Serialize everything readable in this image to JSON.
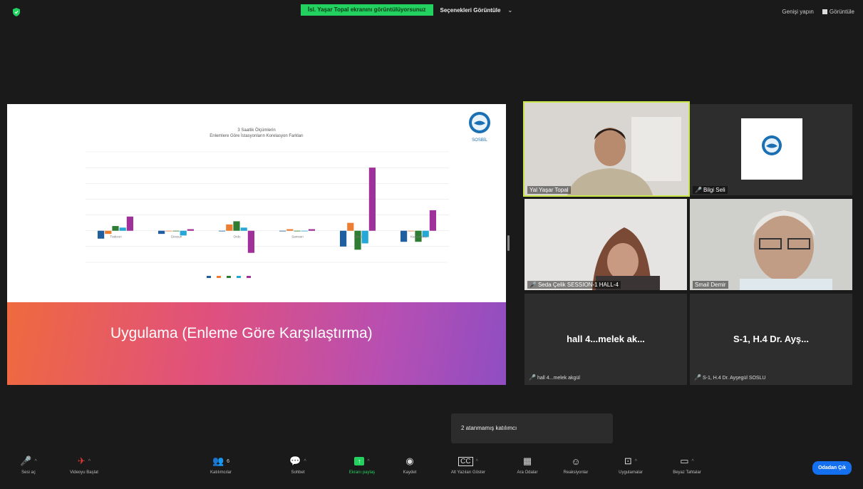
{
  "top": {
    "share_notice": "İsl. Yaşar Topal ekranını görüntülüyorsunuz",
    "view_options": "Seçenekleri Görüntüle",
    "view_options_chevron": "⌄",
    "exit_fullscreen": "Genişi yapın",
    "view_label": "Görüntüle"
  },
  "slide": {
    "banner_text": "Uygulama (Enleme Göre Karşılaştırma)",
    "logo_text": "SOSBİL",
    "chart_title_line1": "3 Saatlik Ölçümlerin",
    "chart_title_line2": "Enlemlere Göre İstasyonların Korelasyon Farkları"
  },
  "chart_data": {
    "type": "bar",
    "title": "3 Saatlik Ölçümlerin Enlemlere Göre İstasyonların Korelasyon Farkları",
    "categories": [
      "Trabzon",
      "Giresun",
      "Ordu",
      "Samsun",
      "Sinop",
      "Kastamonu"
    ],
    "ylim": [
      -0.2,
      0.5
    ],
    "series": [
      {
        "name": "",
        "color": "#1f5fa0",
        "values": [
          -0.05,
          -0.02,
          0.0,
          0.0,
          -0.1,
          -0.07
        ]
      },
      {
        "name": "",
        "color": "#ed7d31",
        "values": [
          -0.02,
          0.0,
          0.04,
          0.01,
          0.05,
          0.0
        ]
      },
      {
        "name": "",
        "color": "#2e7d32",
        "values": [
          0.03,
          0.0,
          0.06,
          0.0,
          -0.12,
          -0.07
        ]
      },
      {
        "name": "",
        "color": "#26a7d6",
        "values": [
          0.02,
          -0.03,
          0.02,
          0.0,
          -0.08,
          -0.04
        ]
      },
      {
        "name": "",
        "color": "#a0309a",
        "values": [
          0.09,
          0.01,
          -0.14,
          0.01,
          0.4,
          0.13
        ]
      }
    ]
  },
  "participants": [
    {
      "name": "Yal Yaşar Topal",
      "muted": false
    },
    {
      "name": "Bilgi Seli",
      "muted": true
    },
    {
      "name": "Seda Çelik SESSION-1 HALL-4",
      "muted": true
    },
    {
      "name": "Smail Demir",
      "muted": false
    },
    {
      "name": "hall 4...melek akgül",
      "display": "hall 4...melek ak...",
      "muted": true
    },
    {
      "name": "S-1, H.4  Dr. Ayşegül SOSLU",
      "display": "S-1, H.4  Dr. Ayş...",
      "muted": true
    }
  ],
  "tooltip": "2 atanmamış katılımcı",
  "toolbar": {
    "audio": "Sesi aç",
    "video": "Videoyu Başlat",
    "participants": "Katılımcılar",
    "participants_count": "6",
    "chat": "Sohbet",
    "share": "Ekranı paylaş",
    "record": "Kaydet",
    "captions": "Alt Yazıları Göster",
    "breakout": "Ara Odalar",
    "reactions": "Reaksiyonlar",
    "apps": "Uygulamalar",
    "whiteboard": "Beyaz Tahtalar",
    "leave": "Odadan Çık"
  },
  "colors": {
    "accent": "#23d160",
    "leave": "#1570ef",
    "active_border": "#c9e64a"
  }
}
